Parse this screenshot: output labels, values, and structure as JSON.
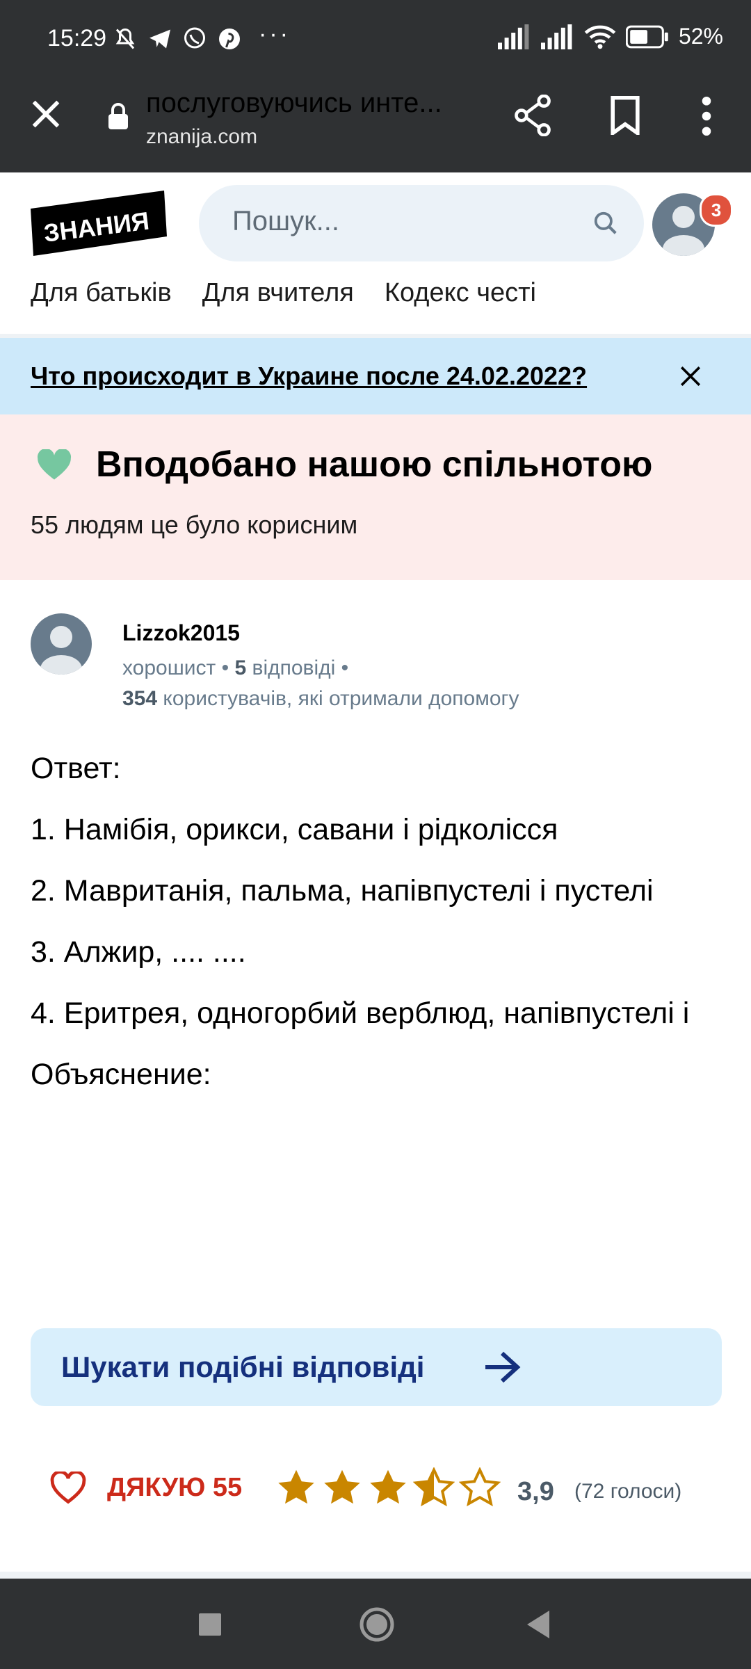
{
  "status_bar": {
    "time": "15:29",
    "more_indicator": "···",
    "battery": "52%"
  },
  "browser": {
    "page_title": "послуговуючись инте...",
    "domain": "znanija.com"
  },
  "header": {
    "logo_text": "ЗНАНИЯ",
    "search_placeholder": "Пошук...",
    "notification_count": "3"
  },
  "nav": {
    "items": [
      "Для батьків",
      "Для вчителя",
      "Кодекс честі"
    ]
  },
  "banner": {
    "text": "Что происходит в Украине после 24.02.2022?"
  },
  "liked": {
    "title": "Вподобано нашою спільнотою",
    "subtitle": "55 людям це було корисним"
  },
  "author": {
    "name": "Lizzok2015",
    "rank": "хорошист",
    "answers_count": "5",
    "answers_label": "відповіді",
    "helped_count": "354",
    "helped_label": "користувачів, які отримали допомогу"
  },
  "answer": {
    "lines": [
      "Ответ:",
      "1. Намібія, орикси, савани і рідколісся",
      "2. Мавританія, пальма, напівпустелі і пустелі",
      "3. Алжир, .... ....",
      "4. Еритрея, одногорбий верблюд, напівпустелі і",
      "Объяснение:"
    ]
  },
  "similar": {
    "label": "Шукати подібні відповіді"
  },
  "rating": {
    "thanks_label": "ДЯКУЮ",
    "thanks_count": "55",
    "stars_value": 3.9,
    "value_text": "3,9",
    "votes_text": "(72 голоси)"
  },
  "colors": {
    "bar_dark": "#2f3133",
    "banner_blue": "#cde9fa",
    "liked_pink": "#fdeceb",
    "accent_navy": "#15307d",
    "star_gold": "#c98600",
    "thanks_red": "#cc2a1a"
  },
  "icons": [
    "close-icon",
    "lock-icon",
    "share-icon",
    "bookmark-icon",
    "more-vert-icon",
    "search-icon",
    "avatar-icon",
    "heart-icon",
    "arrow-right-icon",
    "star-icon"
  ]
}
